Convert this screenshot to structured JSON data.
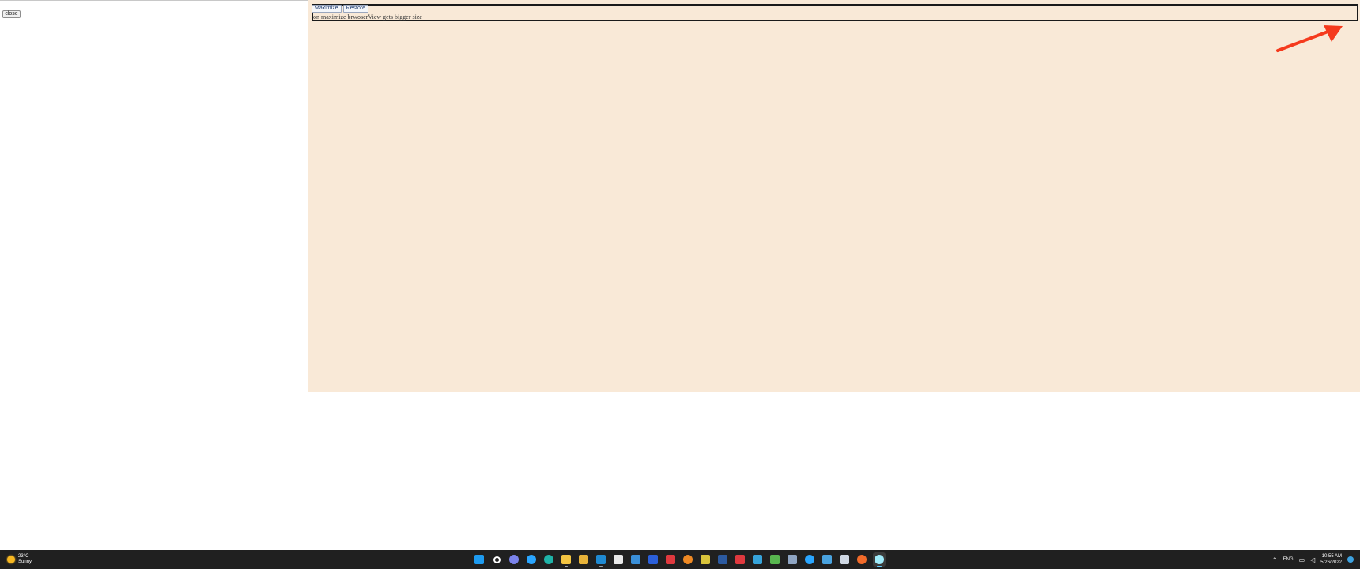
{
  "left_pane": {
    "close_label": "close"
  },
  "browser_view": {
    "maximize_label": "Maximize",
    "restore_label": "Restore",
    "caption": "on maximize brwoserView gets bigger size",
    "background": "#f9e9d7",
    "annotation_arrow_color": "#f53a1d"
  },
  "taskbar": {
    "weather": {
      "temp": "23°C",
      "condition": "Sunny"
    },
    "apps": [
      {
        "name": "start-icon",
        "color": "#1e9bf0"
      },
      {
        "name": "search-icon",
        "color": "#ffffff"
      },
      {
        "name": "chat-icon",
        "color": "#7b83eb"
      },
      {
        "name": "browser-app-icon",
        "color": "#2aa6ff"
      },
      {
        "name": "edge-icon",
        "color": "#1fb3a8"
      },
      {
        "name": "file-explorer-icon",
        "color": "#f4c542"
      },
      {
        "name": "folder-icon",
        "color": "#e8b339"
      },
      {
        "name": "vscode-icon",
        "color": "#1f8ad2"
      },
      {
        "name": "calendar-icon",
        "color": "#e8e8e8"
      },
      {
        "name": "mail-icon",
        "color": "#3a8fd8"
      },
      {
        "name": "phone-app-icon",
        "color": "#2b5fd9"
      },
      {
        "name": "app-red-icon",
        "color": "#e0393e"
      },
      {
        "name": "paint-icon",
        "color": "#f08a24"
      },
      {
        "name": "tools-icon",
        "color": "#d9c43b"
      },
      {
        "name": "powershell-icon",
        "color": "#2c5aa0"
      },
      {
        "name": "app-k-icon",
        "color": "#e0393e"
      },
      {
        "name": "monitor-icon",
        "color": "#36a3d9"
      },
      {
        "name": "photos-icon",
        "color": "#58b74f"
      },
      {
        "name": "calculator-icon",
        "color": "#8fa5c3"
      },
      {
        "name": "app-blue-icon",
        "color": "#2aa6ff"
      },
      {
        "name": "store-icon",
        "color": "#4aa3df"
      },
      {
        "name": "image-viewer-icon",
        "color": "#cfd8e3"
      },
      {
        "name": "firefox-icon",
        "color": "#f26b2a"
      },
      {
        "name": "electron-icon",
        "color": "#9feaf9"
      }
    ],
    "active_app_index": 23,
    "tray": {
      "language": "ENG",
      "time": "10:55 AM",
      "date": "5/26/2022"
    }
  }
}
